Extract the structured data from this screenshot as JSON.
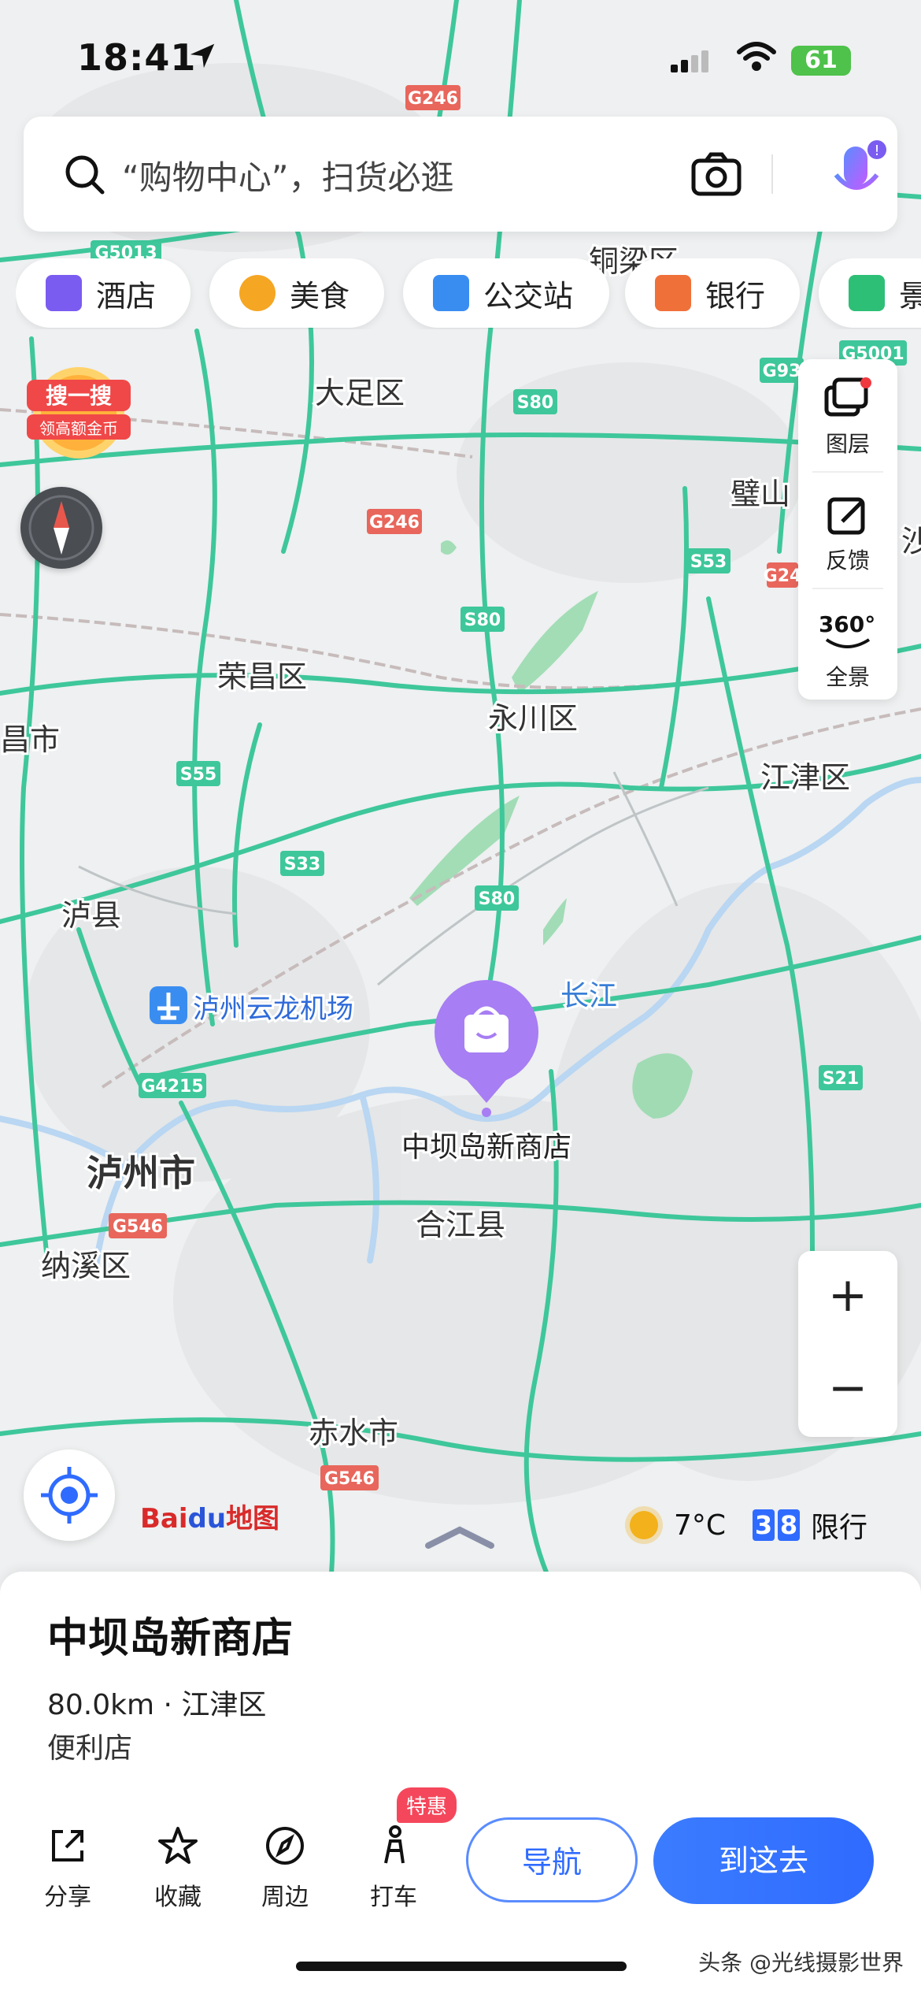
{
  "status_bar": {
    "time": "18:41",
    "battery": "61"
  },
  "search": {
    "placeholder": "“购物中心”，扫货必逛"
  },
  "chips": [
    {
      "label": "酒店",
      "icon": "hotel-icon",
      "color": "#7a5cf0"
    },
    {
      "label": "美食",
      "icon": "food-icon",
      "color": "#f5a623"
    },
    {
      "label": "公交站",
      "icon": "bus-stop-icon",
      "color": "#3a8df0"
    },
    {
      "label": "银行",
      "icon": "bank-icon",
      "color": "#f0703a"
    },
    {
      "label": "景",
      "icon": "scenic-icon",
      "color": "#2dbf76"
    }
  ],
  "promo": {
    "line1": "搜一搜",
    "line2": "领高额金币"
  },
  "side_panel": {
    "layers": "图层",
    "feedback": "反馈",
    "panorama": "全景",
    "panorama_badge": "360°"
  },
  "map_labels": {
    "roads": [
      "G246",
      "G5013",
      "S80",
      "G246",
      "G93",
      "G5001",
      "S53",
      "G24",
      "S80",
      "S55",
      "S33",
      "S80",
      "G4215",
      "G546",
      "S21",
      "G546"
    ],
    "places": [
      "铜梁区",
      "大足区",
      "璧山",
      "荣昌区",
      "永川区",
      "江津区",
      "昌市",
      "泸县",
      "泸州云龙机场",
      "长江",
      "泸州市",
      "合江县",
      "纳溪区",
      "赤水市",
      "沙"
    ],
    "pin_label": "中坝岛新商店"
  },
  "brand": {
    "bai": "Bai",
    "du": "du",
    "map": "地图"
  },
  "weather": {
    "temp": "7°C",
    "limit_digits": [
      "3",
      "8"
    ],
    "limit_label": "限行"
  },
  "poi": {
    "name": "中坝岛新商店",
    "distance": "80.0km",
    "district": "江津区",
    "category": "便利店"
  },
  "actions": {
    "share": "分享",
    "favorite": "收藏",
    "nearby": "周边",
    "taxi": "打车",
    "taxi_tag": "特惠",
    "navigate": "导航",
    "go_here": "到这去"
  },
  "watermark": "头条 @光线摄影世界",
  "colors": {
    "accent": "#2f6bff",
    "road_green": "#3ec79a",
    "pin_purple": "#9b6bf2"
  }
}
